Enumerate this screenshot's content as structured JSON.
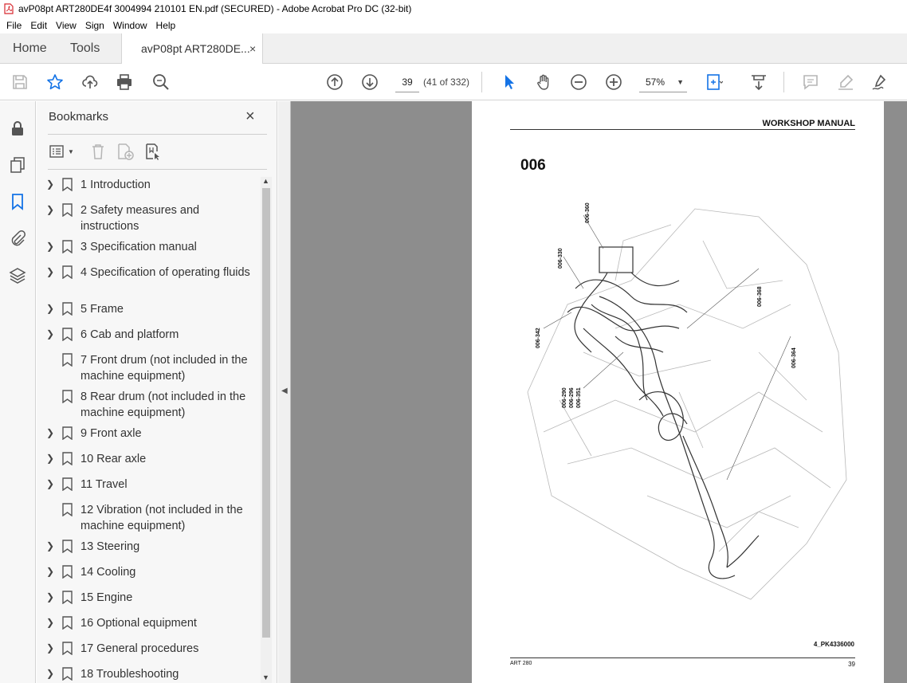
{
  "window": {
    "title": "avP08pt ART280DE4f 3004994 210101 EN.pdf (SECURED) - Adobe Acrobat Pro DC (32-bit)",
    "app_icon": "pdf-icon"
  },
  "menu": {
    "items": [
      "File",
      "Edit",
      "View",
      "Sign",
      "Window",
      "Help"
    ]
  },
  "tabs": {
    "home": "Home",
    "tools": "Tools",
    "document": "avP08pt ART280DE...",
    "close": "×"
  },
  "toolbar": {
    "page_number": "39",
    "page_count": "(41 of 332)",
    "zoom": "57%",
    "icons": [
      "save-icon",
      "star-icon",
      "upload-icon",
      "print-icon",
      "search-zoom-icon",
      "page-up-icon",
      "page-down-icon",
      "select-cursor-icon",
      "hand-icon",
      "zoom-out-icon",
      "zoom-in-icon",
      "fit-page-icon",
      "scroll-mode-icon",
      "comment-icon",
      "highlight-icon",
      "sign-icon"
    ]
  },
  "bookmarks": {
    "title": "Bookmarks",
    "close": "×",
    "items": [
      {
        "label": "1 Introduction",
        "expandable": true
      },
      {
        "label": "2 Safety measures and instructions",
        "expandable": true
      },
      {
        "label": "3 Specification manual",
        "expandable": true
      },
      {
        "label": "4 Specification of operating fluids",
        "expandable": true
      },
      {
        "label": "5 Frame",
        "expandable": true
      },
      {
        "label": "6 Cab and platform",
        "expandable": true
      },
      {
        "label": "7 Front drum (not included in the machine equipment)",
        "expandable": false
      },
      {
        "label": "8 Rear drum (not included in the machine equipment)",
        "expandable": false
      },
      {
        "label": "9 Front axle",
        "expandable": true
      },
      {
        "label": "10 Rear axle",
        "expandable": true
      },
      {
        "label": "11 Travel",
        "expandable": true
      },
      {
        "label": "12 Vibration (not included in the machine equipment)",
        "expandable": false
      },
      {
        "label": "13 Steering",
        "expandable": true
      },
      {
        "label": "14 Cooling",
        "expandable": true
      },
      {
        "label": "15 Engine",
        "expandable": true
      },
      {
        "label": "16 Optional equipment",
        "expandable": true
      },
      {
        "label": "17 General procedures",
        "expandable": true
      },
      {
        "label": "18 Troubleshooting",
        "expandable": true
      }
    ]
  },
  "page": {
    "header": "WORKSHOP MANUAL",
    "section": "006",
    "callouts": [
      "006-360",
      "006-330",
      "006-368",
      "006-342",
      "006-364",
      "006-290",
      "006-296",
      "006-351"
    ],
    "figure_id": "4_PK4336000",
    "footer_left": "ART 280",
    "footer_right": "39"
  },
  "colors": {
    "accent_blue": "#1473e6",
    "doc_background": "#8d8d8d",
    "panel_background": "#f7f7f7",
    "pdf_red": "#d7282f"
  }
}
